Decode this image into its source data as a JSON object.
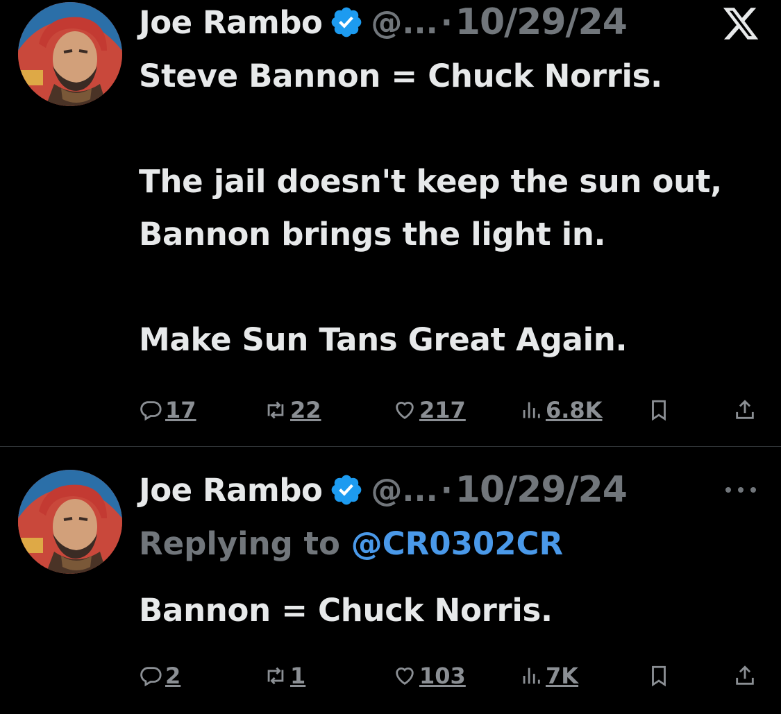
{
  "tweets": [
    {
      "author": {
        "name": "Joe Rambo",
        "handle": "@...",
        "verified": true
      },
      "separator": "·",
      "date": "10/29/24",
      "header_icon": "x-logo-icon",
      "text": "Steve Bannon = Chuck Norris.\n\nThe jail doesn't keep the sun out, Bannon brings the light in.\n\nMake Sun Tans Great Again.",
      "stats": {
        "replies": "17",
        "reposts": "22",
        "likes": "217",
        "views": "6.8K"
      }
    },
    {
      "author": {
        "name": "Joe Rambo",
        "handle": "@...",
        "verified": true
      },
      "separator": "·",
      "date": "10/29/24",
      "header_icon": "more-options-icon",
      "replying_to_label": "Replying to",
      "replying_to_handle": "@CR0302CR",
      "text": "Bannon = Chuck Norris.",
      "stats": {
        "replies": "2",
        "reposts": "1",
        "likes": "103",
        "views": "7K"
      }
    }
  ],
  "colors": {
    "background": "#000000",
    "text": "#e7e9ea",
    "secondary": "#71767b",
    "accent": "#4a99e9",
    "verified": "#1d9bf0",
    "divider": "#2f3336"
  }
}
